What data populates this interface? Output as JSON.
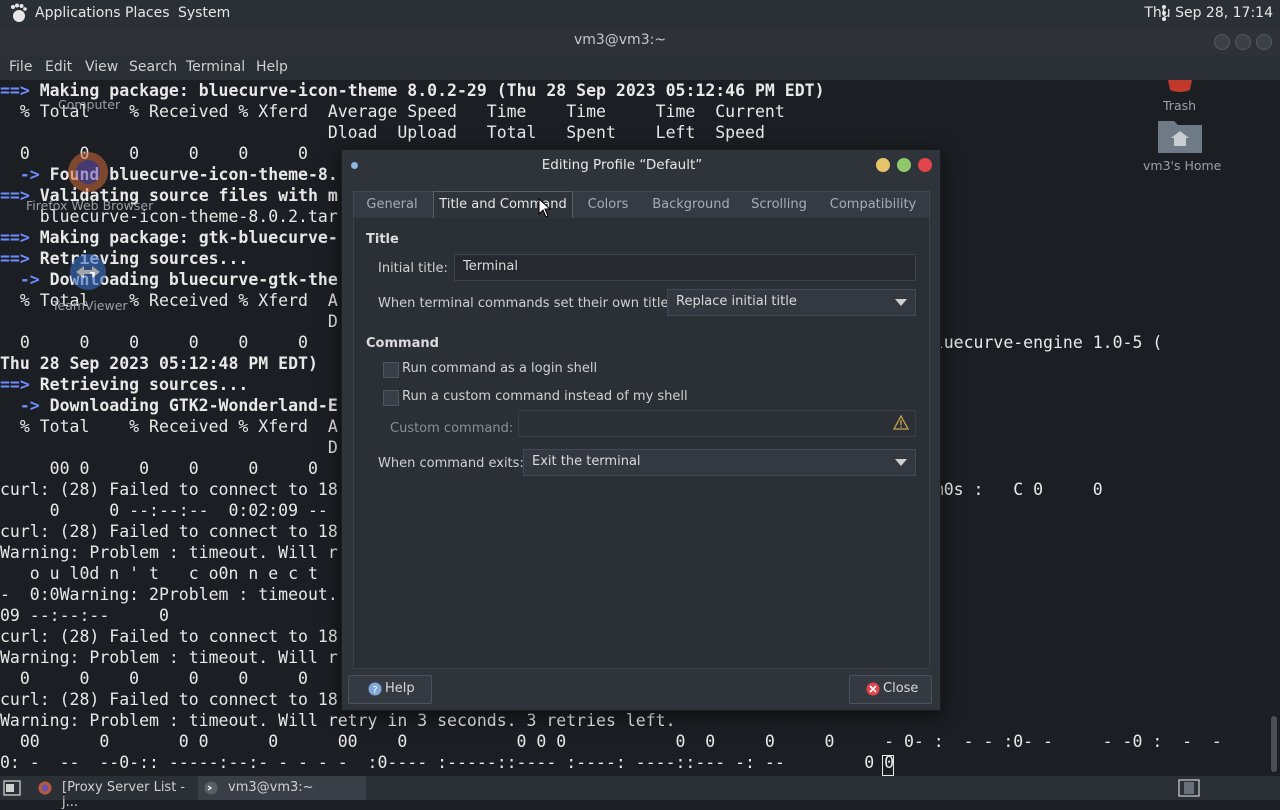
{
  "top_panel": {
    "menus": [
      "Applications",
      "Places",
      "System"
    ],
    "clock": "Thu Sep 28, 17:14"
  },
  "terminal": {
    "title": "vm3@vm3:~",
    "menus": [
      "File",
      "Edit",
      "View",
      "Search",
      "Terminal",
      "Help"
    ],
    "lines": [
      [
        [
          "b",
          "==> "
        ],
        [
          "bold",
          "Making package: bluecurve-icon-theme 8.0.2-29 (Thu 28 Sep 2023 05:12:46 PM EDT)"
        ]
      ],
      [
        [
          "n",
          "  % Total    % Received % Xferd  Average Speed   Time    Time     Time  Current"
        ]
      ],
      [
        [
          "n",
          "                                 Dload  Upload   Total   Spent    Left  Speed"
        ]
      ],
      [
        [
          "n",
          "  0     0    0     0    0     0                                                     sources..."
        ]
      ],
      [
        [
          "b",
          "  -> "
        ],
        [
          "bold",
          "Found bluecurve-icon-theme-8."
        ]
      ],
      [
        [
          "b",
          "==> "
        ],
        [
          "bold",
          "Validating source files with m"
        ]
      ],
      [
        [
          "n",
          "    bluecurve-icon-theme-8.0.2.tar"
        ]
      ],
      [
        [
          "b",
          "==> "
        ],
        [
          "bold",
          "Making package: gtk-bluecurve-"
        ]
      ],
      [
        [
          "b",
          "==> "
        ],
        [
          "bold",
          "Retrieving sources..."
        ]
      ],
      [
        [
          "b",
          "  -> "
        ],
        [
          "bold",
          "Downloading bluecurve-gtk-the"
        ]
      ],
      [
        [
          "n",
          "  % Total    % Received % Xferd  A"
        ]
      ],
      [
        [
          "n",
          "                                 D"
        ]
      ],
      [
        [
          "n",
          "  0     0    0     0    0     0    0                                                age: gtk-bluecurve-engine 1.0-5 ("
        ]
      ],
      [
        [
          "bold",
          "Thu 28 Sep 2023 05:12:48 PM EDT)"
        ]
      ],
      [
        [
          "b",
          "==> "
        ],
        [
          "bold",
          "Retrieving sources..."
        ]
      ],
      [
        [
          "b",
          "  -> "
        ],
        [
          "bold",
          "Downloading GTK2-Wonderland-E"
        ]
      ],
      [
        [
          "n",
          "  % Total    % Received % Xferd  A"
        ]
      ],
      [
        [
          "n",
          "                                 D"
        ]
      ],
      [
        [
          "n",
          "     00 0     0    0     0     0"
        ]
      ],
      [
        [
          "n",
          "curl: (28) Failed to connect to 18                                                   012885 9 m0s :   C 0     0"
        ]
      ],
      [
        [
          "n",
          "     0     0 --:--:--  0:02:09 --"
        ]
      ],
      [
        [
          "n",
          "curl: (28) Failed to connect to 18                                                server"
        ]
      ],
      [
        [
          "n",
          "Warning: Problem : timeout. Will r"
        ]
      ],
      [
        [
          "n",
          "   o u l0d n ' t   c o0n n e c t"
        ]
      ],
      [
        [
          "n",
          "-  0:0Warning: 2Problem : timeout."
        ]
      ],
      [
        [
          "n",
          "09 --:--:--     0"
        ]
      ],
      [
        [
          "n",
          "curl: (28) Failed to connect to 18                                                server"
        ]
      ],
      [
        [
          "n",
          "Warning: Problem : timeout. Will r"
        ]
      ],
      [
        [
          "n",
          "  0     0    0     0    0     0"
        ]
      ],
      [
        [
          "n",
          "curl: (28) Failed to connect to 18                                                server"
        ]
      ],
      [
        [
          "n",
          "Warning: Problem : timeout. Will retry in 3 seconds. 3 retries left."
        ]
      ],
      [
        [
          "n",
          "  00      0       0 0      0      00    0           0 0 0           0  0     0     0     - 0- :  - - :0- -     - -0 :  -  -"
        ]
      ],
      [
        [
          "n",
          "0: -  --  --0-:: -----:--:- - - - -  :0---- :-----::---- :----: ----::--- -: --        0 0"
        ]
      ]
    ]
  },
  "desktop": {
    "icons": [
      "Computer",
      "Firefox Web Browser",
      "TeamViewer",
      "Trash",
      "vm3's Home"
    ]
  },
  "dialog": {
    "title": "Editing Profile “Default”",
    "tabs": [
      "General",
      "Title and Command",
      "Colors",
      "Background",
      "Scrolling",
      "Compatibility"
    ],
    "active_tab": "Title and Command",
    "title_section": "Title",
    "initial_title_label": "Initial title:",
    "initial_title_value": "Terminal",
    "own_titles_label": "When terminal commands set their own titles:",
    "own_titles_value": "Replace initial title",
    "command_section": "Command",
    "login_shell_label": "Run command as a login shell",
    "login_shell_checked": false,
    "custom_cmd_label": "Run a custom command instead of my shell",
    "custom_cmd_checked": false,
    "custom_command_label": "Custom command:",
    "custom_command_value": "",
    "exit_label": "When command exits:",
    "exit_value": "Exit the terminal",
    "help_button": "Help",
    "close_button": "Close"
  },
  "taskbar": {
    "tasks": [
      "[Proxy Server List - j...",
      "vm3@vm3:~"
    ]
  },
  "colors": {
    "accent_blue": "#6f8cff",
    "close_red": "#e0454a",
    "min_yellow": "#e6c56a",
    "max_green": "#8fc86a"
  }
}
